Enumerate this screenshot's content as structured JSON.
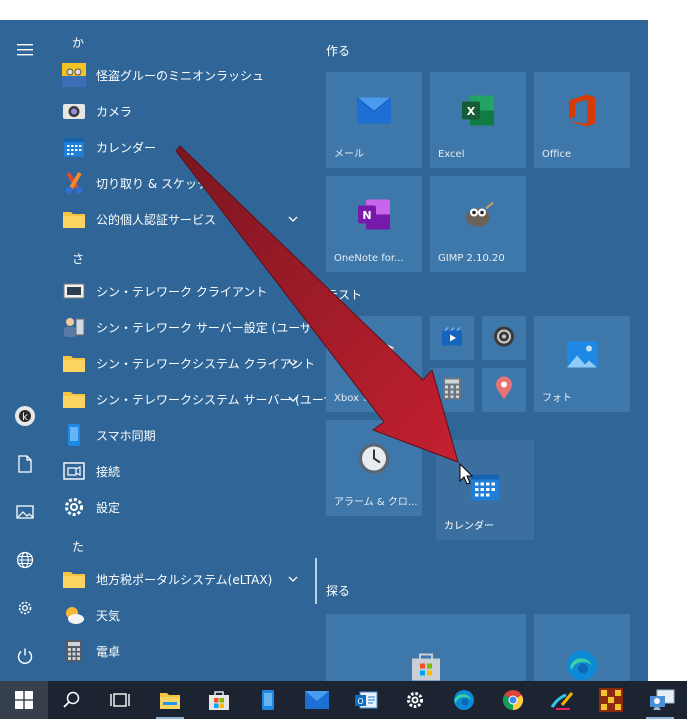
{
  "app_list": {
    "groups": [
      "か",
      "さ",
      "た"
    ],
    "items": [
      {
        "label": "怪盗グルーのミニオンラッシュ"
      },
      {
        "label": "カメラ"
      },
      {
        "label": "カレンダー"
      },
      {
        "label": "切り取り & スケッチ"
      },
      {
        "label": "公的個人認証サービス"
      },
      {
        "label": "シン・テレワーク クライアント"
      },
      {
        "label": "シン・テレワーク サーバー設定 (ユーザー)"
      },
      {
        "label": "シン・テレワークシステム クライアント"
      },
      {
        "label": "シン・テレワークシステム サーバー (ユーザー)"
      },
      {
        "label": "スマホ同期"
      },
      {
        "label": "接続"
      },
      {
        "label": "設定"
      },
      {
        "label": "地方税ポータルシステム(eLTAX)"
      },
      {
        "label": "天気"
      },
      {
        "label": "電卓"
      }
    ]
  },
  "tiles": {
    "section_create": "作る",
    "section_test": "テスト",
    "section_explore": "探る",
    "mail": "メール",
    "excel": "Excel",
    "office": "Office",
    "onenote": "OneNote for...",
    "gimp": "GIMP 2.10.20",
    "xbox": "Xbox コンソール...",
    "photos": "フォト",
    "alarm": "アラーム & クロ...",
    "calendar": "カレンダー"
  },
  "colors": {
    "start_bg": "#2f6697",
    "tile_bg": "#3e77aa",
    "taskbar_bg": "#1b2430",
    "arrow": "#c0212d"
  }
}
